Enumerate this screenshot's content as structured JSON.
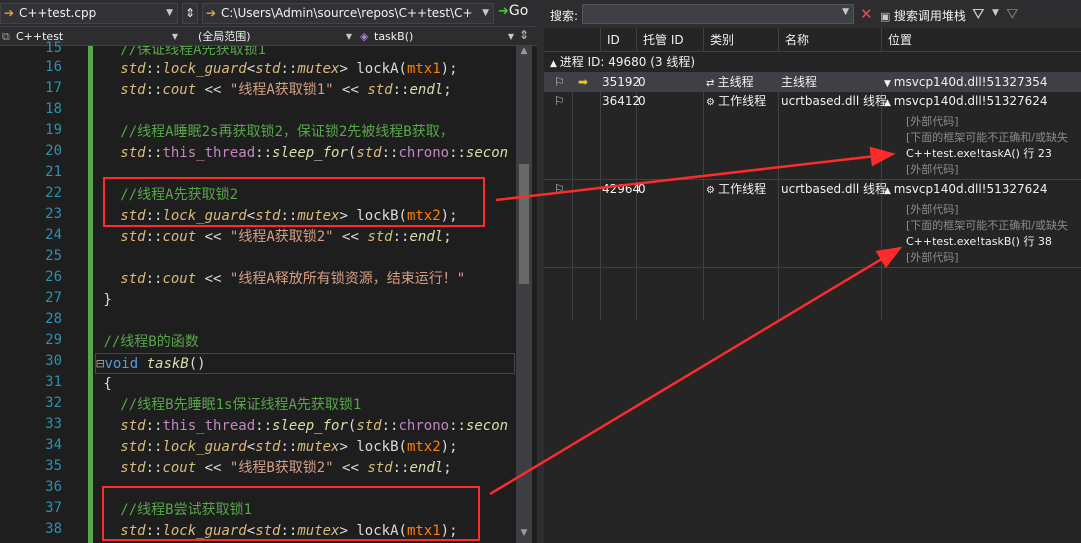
{
  "editor": {
    "file_combo": "C++test.cpp",
    "path_combo": "C:\\Users\\Admin\\source\\repos\\C++test\\C+",
    "go_label": "Go",
    "nav_project": "C++test",
    "nav_scope": "(全局范围)",
    "nav_function": "taskB()",
    "line_numbers": [
      "15",
      "16",
      "17",
      "18",
      "19",
      "20",
      "21",
      "22",
      "23",
      "24",
      "25",
      "26",
      "27",
      "28",
      "29",
      "30",
      "31",
      "32",
      "33",
      "34",
      "35",
      "36",
      "37",
      "38"
    ]
  },
  "threads": {
    "search_label": "搜索:",
    "search_stack_label": "搜索调用堆栈",
    "columns": [
      "ID",
      "托管 ID",
      "类别",
      "名称",
      "位置"
    ],
    "process_label": "进程 ID: 49680 (3 线程)",
    "rows": [
      {
        "id": "35192",
        "managed": "0",
        "category": "主线程",
        "name": "主线程",
        "location": "msvcp140d.dll!51327354"
      },
      {
        "id": "36412",
        "managed": "0",
        "category": "工作线程",
        "name": "ucrtbased.dll 线程",
        "location": "msvcp140d.dll!51327624",
        "frames": [
          "[外部代码]",
          "[下面的框架可能不正确和/或缺失",
          "C++test.exe!taskA() 行 23",
          "[外部代码]"
        ]
      },
      {
        "id": "42964",
        "managed": "0",
        "category": "工作线程",
        "name": "ucrtbased.dll 线程",
        "location": "msvcp140d.dll!51327624",
        "frames": [
          "[外部代码]",
          "[下面的框架可能不正确和/或缺失",
          "C++test.exe!taskB() 行 38",
          "[外部代码]"
        ]
      }
    ]
  },
  "colors": {
    "annotation_red": "#ff2b2b",
    "comment_green": "#57a64a",
    "line_number_blue": "#2b91af"
  }
}
